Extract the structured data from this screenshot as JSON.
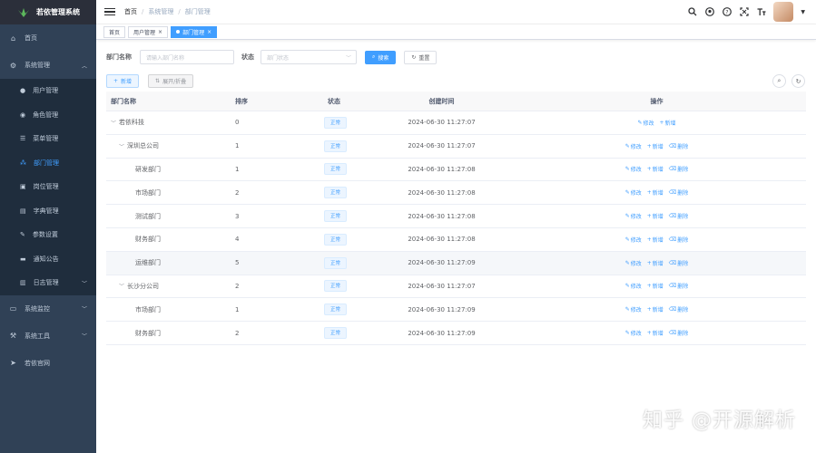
{
  "app": {
    "title": "若依管理系统"
  },
  "sidebar": {
    "items": [
      {
        "label": "首页",
        "icon": "dashboard-icon"
      },
      {
        "label": "系统管理",
        "icon": "gear-icon",
        "expanded": true,
        "children": [
          {
            "label": "用户管理",
            "icon": "user-icon"
          },
          {
            "label": "角色管理",
            "icon": "peoples-icon"
          },
          {
            "label": "菜单管理",
            "icon": "tree-table-icon"
          },
          {
            "label": "部门管理",
            "icon": "tree-icon",
            "active": true
          },
          {
            "label": "岗位管理",
            "icon": "post-icon"
          },
          {
            "label": "字典管理",
            "icon": "dict-icon"
          },
          {
            "label": "参数设置",
            "icon": "edit-icon"
          },
          {
            "label": "通知公告",
            "icon": "message-icon"
          },
          {
            "label": "日志管理",
            "icon": "log-icon"
          }
        ]
      },
      {
        "label": "系统监控",
        "icon": "monitor-icon"
      },
      {
        "label": "系统工具",
        "icon": "tool-icon"
      },
      {
        "label": "若依官网",
        "icon": "guide-icon"
      }
    ]
  },
  "breadcrumb": [
    "首页",
    "系统管理",
    "部门管理"
  ],
  "tags": [
    {
      "label": "首页"
    },
    {
      "label": "用户管理"
    },
    {
      "label": "部门管理",
      "active": true
    }
  ],
  "search": {
    "dept_label": "部门名称",
    "dept_placeholder": "请输入部门名称",
    "status_label": "状态",
    "status_placeholder": "部门状态",
    "search_btn": "搜索",
    "reset_btn": "重置"
  },
  "toolbar": {
    "add_btn": "新增",
    "expand_btn": "展开/折叠"
  },
  "table": {
    "headers": [
      "部门名称",
      "排序",
      "状态",
      "创建时间",
      "操作"
    ],
    "rows": [
      {
        "name": "若依科技",
        "sort": "0",
        "status": "正常",
        "time": "2024-06-30 11:27:07",
        "ops": [
          "修改",
          "新增"
        ]
      },
      {
        "name": "深圳总公司",
        "sort": "1",
        "status": "正常",
        "time": "2024-06-30 11:27:07",
        "ops": [
          "修改",
          "新增",
          "删除"
        ]
      },
      {
        "name": "研发部门",
        "sort": "1",
        "status": "正常",
        "time": "2024-06-30 11:27:08",
        "ops": [
          "修改",
          "新增",
          "删除"
        ]
      },
      {
        "name": "市场部门",
        "sort": "2",
        "status": "正常",
        "time": "2024-06-30 11:27:08",
        "ops": [
          "修改",
          "新增",
          "删除"
        ]
      },
      {
        "name": "测试部门",
        "sort": "3",
        "status": "正常",
        "time": "2024-06-30 11:27:08",
        "ops": [
          "修改",
          "新增",
          "删除"
        ]
      },
      {
        "name": "财务部门",
        "sort": "4",
        "status": "正常",
        "time": "2024-06-30 11:27:08",
        "ops": [
          "修改",
          "新增",
          "删除"
        ]
      },
      {
        "name": "运维部门",
        "sort": "5",
        "status": "正常",
        "time": "2024-06-30 11:27:09",
        "ops": [
          "修改",
          "新增",
          "删除"
        ]
      },
      {
        "name": "长沙分公司",
        "sort": "2",
        "status": "正常",
        "time": "2024-06-30 11:27:07",
        "ops": [
          "修改",
          "新增",
          "删除"
        ]
      },
      {
        "name": "市场部门",
        "sort": "1",
        "status": "正常",
        "time": "2024-06-30 11:27:09",
        "ops": [
          "修改",
          "新增",
          "删除"
        ]
      },
      {
        "name": "财务部门",
        "sort": "2",
        "status": "正常",
        "time": "2024-06-30 11:27:09",
        "ops": [
          "修改",
          "新增",
          "删除"
        ]
      }
    ]
  },
  "watermark": "知乎 @开源解析",
  "colors": {
    "sidebar_bg": "#304156",
    "accent": "#409eff"
  }
}
